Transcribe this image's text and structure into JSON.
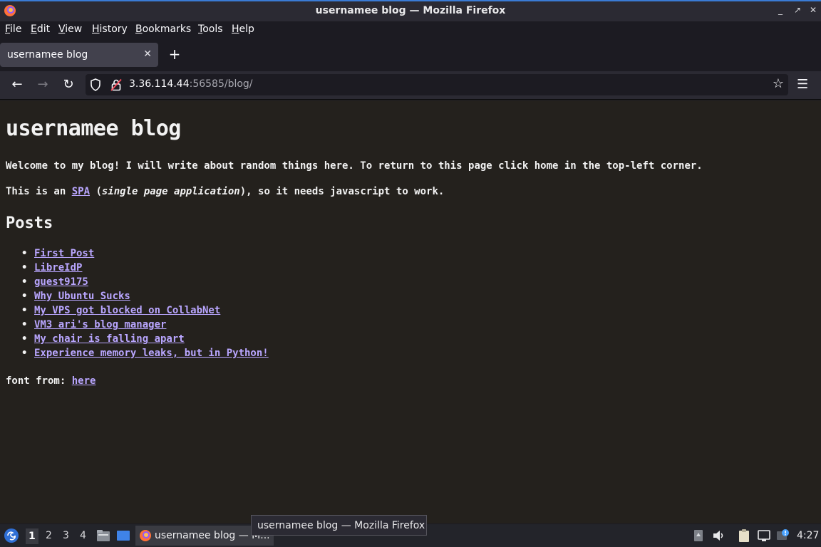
{
  "window": {
    "title": "usernamee blog — Mozilla Firefox",
    "controls": [
      "_",
      "↗",
      "✕"
    ]
  },
  "menubar": {
    "items": [
      "File",
      "Edit",
      "View",
      "History",
      "Bookmarks",
      "Tools",
      "Help"
    ]
  },
  "tabs": [
    {
      "label": "usernamee blog"
    }
  ],
  "navbar": {
    "url_host": "3.36.114.44",
    "url_rest": ":56585/blog/"
  },
  "page": {
    "heading": "usernamee blog",
    "welcome": "Welcome to my blog! I will write about random things here. To return to this page click home in the top-left corner.",
    "spa_prefix": "This is an ",
    "spa_link": "SPA",
    "spa_open": " (",
    "spa_italic": "single page application",
    "spa_suffix": "), so it needs javascript to work.",
    "posts_heading": "Posts",
    "posts": [
      "First Post",
      "LibreIdP",
      "guest9175",
      "Why Ubuntu Sucks",
      "My VPS got blocked on CollabNet",
      "VM3 ari's blog manager",
      "My chair is falling apart",
      "Experience memory leaks, but in Python!"
    ],
    "font_prefix": "font from: ",
    "font_link": "here"
  },
  "tooltip": {
    "text": "usernamee blog — Mozilla Firefox"
  },
  "taskbar": {
    "workspaces": [
      "1",
      "2",
      "3",
      "4"
    ],
    "task_label": "usernamee blog — M...",
    "clock": "4:27"
  },
  "colors": {
    "link": "#b9a6ff",
    "page_bg": "#24211d",
    "chrome_bg": "#2b2a33"
  }
}
